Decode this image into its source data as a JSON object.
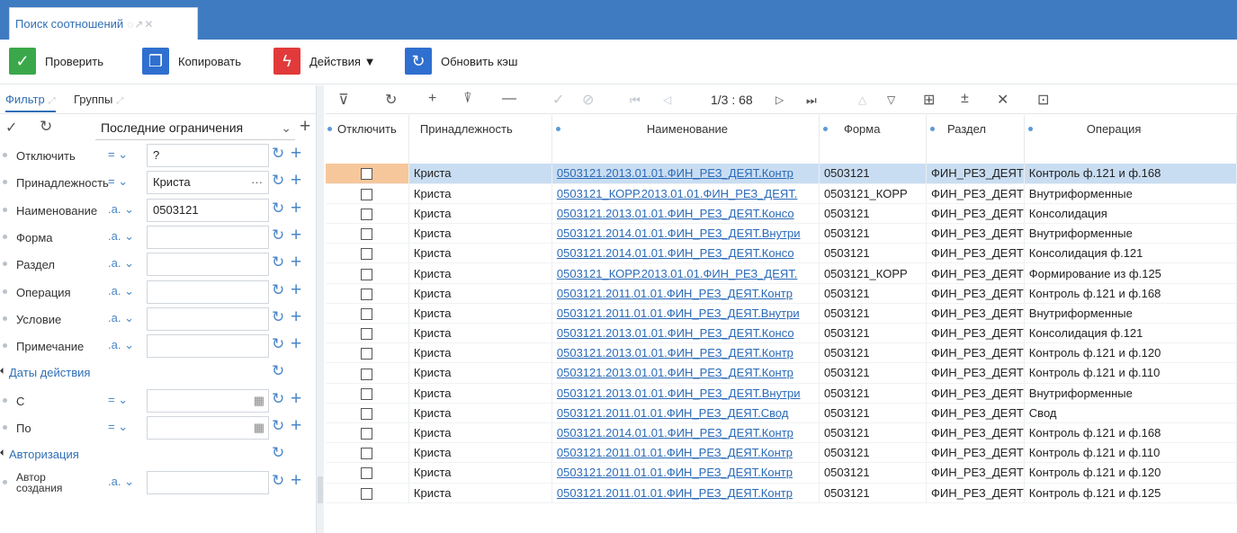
{
  "tab": {
    "title": "Поиск соотношений",
    "tools": "◌↗✕"
  },
  "toolbar": {
    "check": "Проверить",
    "copy": "Копировать",
    "actions": "Действия ▼",
    "refresh_cache": "Обновить кэш",
    "colors": {
      "check": "#3aa84a",
      "copy": "#2f6fd0",
      "actions": "#e23a3a",
      "refresh": "#2f6fd0"
    }
  },
  "left_tabs": {
    "filter": "Фильтр",
    "groups": "Группы"
  },
  "filter": {
    "preset": "Последние ограничения",
    "rows": [
      {
        "label": "Отключить",
        "op": "= ⌄",
        "value": "?"
      },
      {
        "label": "Принадлежность",
        "op": "= ⌄",
        "value": "Криста",
        "extra": "···"
      },
      {
        "label": "Наименование",
        "op": ".a. ⌄",
        "value": "0503121"
      },
      {
        "label": "Форма",
        "op": ".a. ⌄",
        "value": ""
      },
      {
        "label": "Раздел",
        "op": ".a. ⌄",
        "value": ""
      },
      {
        "label": "Операция",
        "op": ".a. ⌄",
        "value": ""
      },
      {
        "label": "Условие",
        "op": ".a. ⌄",
        "value": ""
      },
      {
        "label": "Примечание",
        "op": ".a. ⌄",
        "value": ""
      }
    ],
    "section_dates": "Даты действия",
    "date_rows": [
      {
        "label": "С",
        "op": "= ⌄",
        "value": ""
      },
      {
        "label": "По",
        "op": "= ⌄",
        "value": ""
      }
    ],
    "section_auth": "Авторизация",
    "auth_rows": [
      {
        "label": "Автор\nсоздания",
        "op": ".a. ⌄",
        "value": ""
      }
    ]
  },
  "grid": {
    "pager": "1/3 : 68",
    "columns": [
      "Отключить",
      "Принадлежность",
      "Наименование",
      "Форма",
      "Раздел",
      "Операция"
    ],
    "rows": [
      [
        "",
        "Криста",
        "0503121.2013.01.01.ФИН_РЕЗ_ДЕЯТ.Контр",
        "0503121",
        "ФИН_РЕЗ_ДЕЯТ",
        "Контроль ф.121 и ф.168"
      ],
      [
        "",
        "Криста",
        "0503121_КОРР.2013.01.01.ФИН_РЕЗ_ДЕЯТ.",
        "0503121_КОРР",
        "ФИН_РЕЗ_ДЕЯТ",
        "Внутриформенные"
      ],
      [
        "",
        "Криста",
        "0503121.2013.01.01.ФИН_РЕЗ_ДЕЯТ.Консо",
        "0503121",
        "ФИН_РЕЗ_ДЕЯТ",
        "Консолидация"
      ],
      [
        "",
        "Криста",
        "0503121.2014.01.01.ФИН_РЕЗ_ДЕЯТ.Внутри",
        "0503121",
        "ФИН_РЕЗ_ДЕЯТ",
        "Внутриформенные"
      ],
      [
        "",
        "Криста",
        "0503121.2014.01.01.ФИН_РЕЗ_ДЕЯТ.Консо",
        "0503121",
        "ФИН_РЕЗ_ДЕЯТ",
        "Консолидация ф.121"
      ],
      [
        "",
        "Криста",
        "0503121_КОРР.2013.01.01.ФИН_РЕЗ_ДЕЯТ.",
        "0503121_КОРР",
        "ФИН_РЕЗ_ДЕЯТ",
        "Формирование из ф.125"
      ],
      [
        "",
        "Криста",
        "0503121.2011.01.01.ФИН_РЕЗ_ДЕЯТ.Контр",
        "0503121",
        "ФИН_РЕЗ_ДЕЯТ",
        "Контроль ф.121 и ф.168"
      ],
      [
        "",
        "Криста",
        "0503121.2011.01.01.ФИН_РЕЗ_ДЕЯТ.Внутри",
        "0503121",
        "ФИН_РЕЗ_ДЕЯТ",
        "Внутриформенные"
      ],
      [
        "",
        "Криста",
        "0503121.2013.01.01.ФИН_РЕЗ_ДЕЯТ.Консо",
        "0503121",
        "ФИН_РЕЗ_ДЕЯТ",
        "Консолидация ф.121"
      ],
      [
        "",
        "Криста",
        "0503121.2013.01.01.ФИН_РЕЗ_ДЕЯТ.Контр",
        "0503121",
        "ФИН_РЕЗ_ДЕЯТ",
        "Контроль ф.121 и ф.120"
      ],
      [
        "",
        "Криста",
        "0503121.2013.01.01.ФИН_РЕЗ_ДЕЯТ.Контр",
        "0503121",
        "ФИН_РЕЗ_ДЕЯТ",
        "Контроль ф.121 и ф.110"
      ],
      [
        "",
        "Криста",
        "0503121.2013.01.01.ФИН_РЕЗ_ДЕЯТ.Внутри",
        "0503121",
        "ФИН_РЕЗ_ДЕЯТ",
        "Внутриформенные"
      ],
      [
        "",
        "Криста",
        "0503121.2011.01.01.ФИН_РЕЗ_ДЕЯТ.Свод",
        "0503121",
        "ФИН_РЕЗ_ДЕЯТ",
        "Свод"
      ],
      [
        "",
        "Криста",
        "0503121.2014.01.01.ФИН_РЕЗ_ДЕЯТ.Контр",
        "0503121",
        "ФИН_РЕЗ_ДЕЯТ",
        "Контроль ф.121 и ф.168"
      ],
      [
        "",
        "Криста",
        "0503121.2011.01.01.ФИН_РЕЗ_ДЕЯТ.Контр",
        "0503121",
        "ФИН_РЕЗ_ДЕЯТ",
        "Контроль ф.121 и ф.110"
      ],
      [
        "",
        "Криста",
        "0503121.2011.01.01.ФИН_РЕЗ_ДЕЯТ.Контр",
        "0503121",
        "ФИН_РЕЗ_ДЕЯТ",
        "Контроль ф.121 и ф.120"
      ],
      [
        "",
        "Криста",
        "0503121.2011.01.01.ФИН_РЕЗ_ДЕЯТ.Контр",
        "0503121",
        "ФИН_РЕЗ_ДЕЯТ",
        "Контроль ф.121 и ф.125"
      ]
    ]
  }
}
